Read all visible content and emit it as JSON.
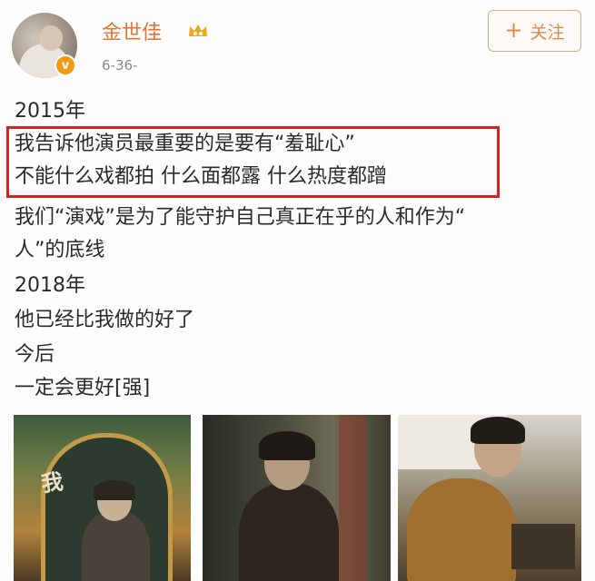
{
  "header": {
    "username": "金世佳",
    "timestamp": "6-36-",
    "follow_label": "关注",
    "follow_icon": "plus-icon",
    "verified_badge_label": "v",
    "accent_color": "#e8732f",
    "badge_color": "#f29b15"
  },
  "post": {
    "lines": [
      "2015年",
      "我告诉他演员最重要的是要有“羞耻心”",
      "不能什么戏都拍 什么面都露 什么热度都蹭",
      "我们“演戏”是为了能守护自己真正在乎的人和作为“",
      "人”的底线",
      "2018年",
      "他已经比我做的好了",
      "今后",
      "一定会更好[强]"
    ],
    "highlight_color": "#d32424"
  },
  "photos": {
    "first_photo_text": "我"
  }
}
